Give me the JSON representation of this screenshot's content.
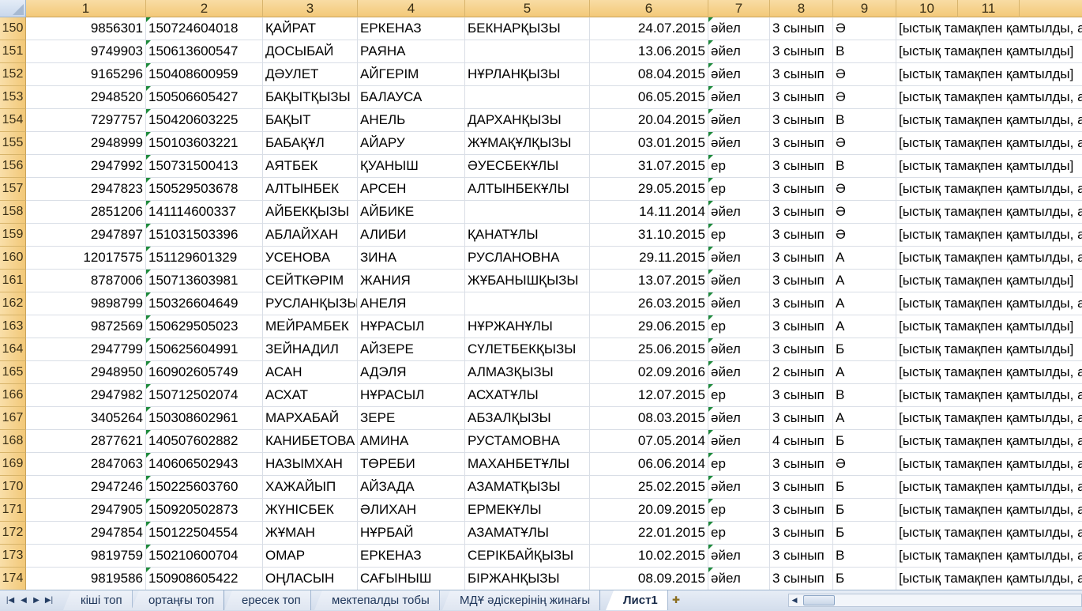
{
  "columns": [
    "1",
    "2",
    "3",
    "4",
    "5",
    "6",
    "7",
    "8",
    "9",
    "10",
    "11"
  ],
  "rows": [
    {
      "row_num": "150",
      "c1": "9856301",
      "c2": "150724604018",
      "c3": "ҚАЙРАТ",
      "c4": "ЕРКЕНАЗ",
      "c5": "БЕКНАРҚЫЗЫ",
      "c6": "24.07.2015",
      "c7": "әйел",
      "c8": "3 сынып",
      "c9": "Ә",
      "c10": "[ыстық тамақпен қамтылды, а"
    },
    {
      "row_num": "151",
      "c1": "9749903",
      "c2": "150613600547",
      "c3": "ДОСЫБАЙ",
      "c4": "РАЯНА",
      "c5": "",
      "c6": "13.06.2015",
      "c7": "әйел",
      "c8": "3 сынып",
      "c9": "В",
      "c10": "[ыстық тамақпен қамтылды]"
    },
    {
      "row_num": "152",
      "c1": "9165296",
      "c2": "150408600959",
      "c3": "ДӘУЛЕТ",
      "c4": "АЙГЕРІМ",
      "c5": "НҰРЛАНҚЫЗЫ",
      "c6": "08.04.2015",
      "c7": "әйел",
      "c8": "3 сынып",
      "c9": "Ә",
      "c10": "[ыстық тамақпен қамтылды]"
    },
    {
      "row_num": "153",
      "c1": "2948520",
      "c2": "150506605427",
      "c3": "БАҚЫТҚЫЗЫ",
      "c4": "БАЛАУСА",
      "c5": "",
      "c6": "06.05.2015",
      "c7": "әйел",
      "c8": "3 сынып",
      "c9": "Ә",
      "c10": "[ыстық тамақпен қамтылды, а"
    },
    {
      "row_num": "154",
      "c1": "7297757",
      "c2": "150420603225",
      "c3": "БАҚЫТ",
      "c4": "АНЕЛЬ",
      "c5": "ДАРХАНҚЫЗЫ",
      "c6": "20.04.2015",
      "c7": "әйел",
      "c8": "3 сынып",
      "c9": "В",
      "c10": "[ыстық тамақпен қамтылды, а"
    },
    {
      "row_num": "155",
      "c1": "2948999",
      "c2": "150103603221",
      "c3": "БАБАҚҰЛ",
      "c4": "АЙАРУ",
      "c5": "ЖҰМАҚҰЛҚЫЗЫ",
      "c6": "03.01.2015",
      "c7": "әйел",
      "c8": "3 сынып",
      "c9": "Ә",
      "c10": "[ыстық тамақпен қамтылды, а"
    },
    {
      "row_num": "156",
      "c1": "2947992",
      "c2": "150731500413",
      "c3": "АЯТБЕК",
      "c4": "ҚУАНЫШ",
      "c5": "ӘУЕСБЕКҰЛЫ",
      "c6": "31.07.2015",
      "c7": "ер",
      "c8": "3 сынып",
      "c9": "В",
      "c10": "[ыстық тамақпен қамтылды]"
    },
    {
      "row_num": "157",
      "c1": "2947823",
      "c2": "150529503678",
      "c3": "АЛТЫНБЕК",
      "c4": "АРСЕН",
      "c5": "АЛТЫНБЕКҰЛЫ",
      "c6": "29.05.2015",
      "c7": "ер",
      "c8": "3 сынып",
      "c9": "Ә",
      "c10": "[ыстық тамақпен қамтылды, а"
    },
    {
      "row_num": "158",
      "c1": "2851206",
      "c2": "141114600337",
      "c3": "АЙБЕКҚЫЗЫ",
      "c4": "АЙБИКЕ",
      "c5": "",
      "c6": "14.11.2014",
      "c7": "әйел",
      "c8": "3 сынып",
      "c9": "Ә",
      "c10": "[ыстық тамақпен қамтылды, а"
    },
    {
      "row_num": "159",
      "c1": "2947897",
      "c2": "151031503396",
      "c3": "АБЛАЙХАН",
      "c4": "АЛИБИ",
      "c5": "ҚАНАТҰЛЫ",
      "c6": "31.10.2015",
      "c7": "ер",
      "c8": "3 сынып",
      "c9": "Ә",
      "c10": "[ыстық тамақпен қамтылды, а"
    },
    {
      "row_num": "160",
      "c1": "12017575",
      "c2": "151129601329",
      "c3": "УСЕНОВА",
      "c4": "ЗИНА",
      "c5": "РУСЛАНОВНА",
      "c6": "29.11.2015",
      "c7": "әйел",
      "c8": "3 сынып",
      "c9": "А",
      "c10": "[ыстық тамақпен қамтылды, а"
    },
    {
      "row_num": "161",
      "c1": "8787006",
      "c2": "150713603981",
      "c3": "СЕЙТКӘРІМ",
      "c4": "ЖАНИЯ",
      "c5": "ЖҰБАНЫШҚЫЗЫ",
      "c6": "13.07.2015",
      "c7": "әйел",
      "c8": "3 сынып",
      "c9": "А",
      "c10": "[ыстық тамақпен қамтылды]"
    },
    {
      "row_num": "162",
      "c1": "9898799",
      "c2": "150326604649",
      "c3": "РУСЛАНҚЫЗЫ",
      "c4": "АНЕЛЯ",
      "c5": "",
      "c6": "26.03.2015",
      "c7": "әйел",
      "c8": "3 сынып",
      "c9": "А",
      "c10": "[ыстық тамақпен қамтылды, а"
    },
    {
      "row_num": "163",
      "c1": "9872569",
      "c2": "150629505023",
      "c3": "МЕЙРАМБЕК",
      "c4": "НҰРАСЫЛ",
      "c5": "НҰРЖАНҰЛЫ",
      "c6": "29.06.2015",
      "c7": "ер",
      "c8": "3 сынып",
      "c9": "А",
      "c10": "[ыстық тамақпен қамтылды]"
    },
    {
      "row_num": "164",
      "c1": "2947799",
      "c2": "150625604991",
      "c3": "ЗЕЙНАДИЛ",
      "c4": "АЙЗЕРЕ",
      "c5": "СҮЛЕТБЕКҚЫЗЫ",
      "c6": "25.06.2015",
      "c7": "әйел",
      "c8": "3 сынып",
      "c9": "Б",
      "c10": "[ыстық тамақпен қамтылды]"
    },
    {
      "row_num": "165",
      "c1": "2948950",
      "c2": "160902605749",
      "c3": "АСАН",
      "c4": "АДЭЛЯ",
      "c5": "АЛМАЗҚЫЗЫ",
      "c6": "02.09.2016",
      "c7": "әйел",
      "c8": "2 сынып",
      "c9": "А",
      "c10": "[ыстық тамақпен қамтылды, а"
    },
    {
      "row_num": "166",
      "c1": "2947982",
      "c2": "150712502074",
      "c3": "АСХАТ",
      "c4": "НҰРАСЫЛ",
      "c5": "АСХАТҰЛЫ",
      "c6": "12.07.2015",
      "c7": "ер",
      "c8": "3 сынып",
      "c9": "В",
      "c10": "[ыстық тамақпен қамтылды, а"
    },
    {
      "row_num": "167",
      "c1": "3405264",
      "c2": "150308602961",
      "c3": "МАРХАБАЙ",
      "c4": "ЗЕРЕ",
      "c5": "АБЗАЛҚЫЗЫ",
      "c6": "08.03.2015",
      "c7": "әйел",
      "c8": "3 сынып",
      "c9": "А",
      "c10": "[ыстық тамақпен қамтылды, а"
    },
    {
      "row_num": "168",
      "c1": "2877621",
      "c2": "140507602882",
      "c3": "КАНИБЕТОВА",
      "c4": "АМИНА",
      "c5": "РУСТАМОВНА",
      "c6": "07.05.2014",
      "c7": "әйел",
      "c8": "4 сынып",
      "c9": "Б",
      "c10": "[ыстық тамақпен қамтылды, а"
    },
    {
      "row_num": "169",
      "c1": "2847063",
      "c2": "140606502943",
      "c3": "НАЗЫМХАН",
      "c4": "ТӨРЕБИ",
      "c5": "МАХАНБЕТҰЛЫ",
      "c6": "06.06.2014",
      "c7": "ер",
      "c8": "3 сынып",
      "c9": "Ә",
      "c10": "[ыстық тамақпен қамтылды, а"
    },
    {
      "row_num": "170",
      "c1": "2947246",
      "c2": "150225603760",
      "c3": "ХАЖАЙЫП",
      "c4": "АЙЗАДА",
      "c5": "АЗАМАТҚЫЗЫ",
      "c6": "25.02.2015",
      "c7": "әйел",
      "c8": "3 сынып",
      "c9": "Б",
      "c10": "[ыстық тамақпен қамтылды, а"
    },
    {
      "row_num": "171",
      "c1": "2947905",
      "c2": "150920502873",
      "c3": "ЖҮНІСБЕК",
      "c4": "ӘЛИХАН",
      "c5": "ЕРМЕКҰЛЫ",
      "c6": "20.09.2015",
      "c7": "ер",
      "c8": "3 сынып",
      "c9": "Б",
      "c10": "[ыстық тамақпен қамтылды, а"
    },
    {
      "row_num": "172",
      "c1": "2947854",
      "c2": "150122504554",
      "c3": "ЖҰМАН",
      "c4": "НҰРБАЙ",
      "c5": "АЗАМАТҰЛЫ",
      "c6": "22.01.2015",
      "c7": "ер",
      "c8": "3 сынып",
      "c9": "Б",
      "c10": "[ыстық тамақпен қамтылды, а"
    },
    {
      "row_num": "173",
      "c1": "9819759",
      "c2": "150210600704",
      "c3": "ОМАР",
      "c4": "ЕРКЕНАЗ",
      "c5": "СЕРІКБАЙҚЫЗЫ",
      "c6": "10.02.2015",
      "c7": "әйел",
      "c8": "3 сынып",
      "c9": "В",
      "c10": "[ыстық тамақпен қамтылды, а"
    },
    {
      "row_num": "174",
      "c1": "9819586",
      "c2": "150908605422",
      "c3": "ОҢЛАСЫН",
      "c4": "САҒЫНЫШ",
      "c5": "БІРЖАНҚЫЗЫ",
      "c6": "08.09.2015",
      "c7": "әйел",
      "c8": "3 сынып",
      "c9": "Б",
      "c10": "[ыстық тамақпен қамтылды, а"
    }
  ],
  "sheet_tabs": [
    {
      "label": "кіші топ",
      "active": false
    },
    {
      "label": "ортаңғы топ",
      "active": false
    },
    {
      "label": "ересек топ",
      "active": false
    },
    {
      "label": "мектепалды тобы",
      "active": false
    },
    {
      "label": "МДҰ әдіскерінің жинағы",
      "active": false
    },
    {
      "label": "Лист1",
      "active": true
    }
  ],
  "nav_icons": [
    "first-sheet-icon",
    "prev-sheet-icon",
    "next-sheet-icon",
    "last-sheet-icon"
  ],
  "colors": {
    "header_bg": "#f3c979",
    "grid_line": "#d9dee6",
    "error_triangle": "#1d8a3b",
    "tab_bar_bg": "#d3ddec"
  }
}
